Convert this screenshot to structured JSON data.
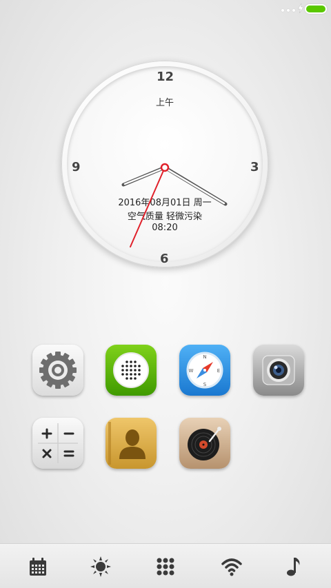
{
  "status_bar": {
    "battery_color": "#5ac800"
  },
  "clock": {
    "numerals": {
      "twelve": "12",
      "three": "3",
      "six": "6",
      "nine": "9"
    },
    "ampm": "上午",
    "date": "2016年08月01日 周一",
    "air_quality": "空气质量 轻微污染",
    "time": "08:20",
    "hands": {
      "hour": 8,
      "minute": 20
    },
    "second_hand_color": "#e0202a"
  },
  "apps": [
    {
      "name": "settings",
      "icon": "gear-icon"
    },
    {
      "name": "messages",
      "icon": "speaker-grille-icon",
      "color": "#58b000"
    },
    {
      "name": "browser",
      "icon": "compass-icon",
      "color": "#2a8de0"
    },
    {
      "name": "camera",
      "icon": "camera-lens-icon"
    },
    {
      "name": "calculator",
      "icon": "calculator-icon"
    },
    {
      "name": "contacts",
      "icon": "person-icon",
      "color": "#d9aa4a"
    },
    {
      "name": "music",
      "icon": "vinyl-record-icon",
      "color": "#c8a888"
    }
  ],
  "dock": {
    "items": [
      {
        "icon": "calendar-icon"
      },
      {
        "icon": "brightness-sun-icon"
      },
      {
        "icon": "app-grid-icon"
      },
      {
        "icon": "wifi-icon"
      },
      {
        "icon": "music-note-icon"
      }
    ]
  }
}
